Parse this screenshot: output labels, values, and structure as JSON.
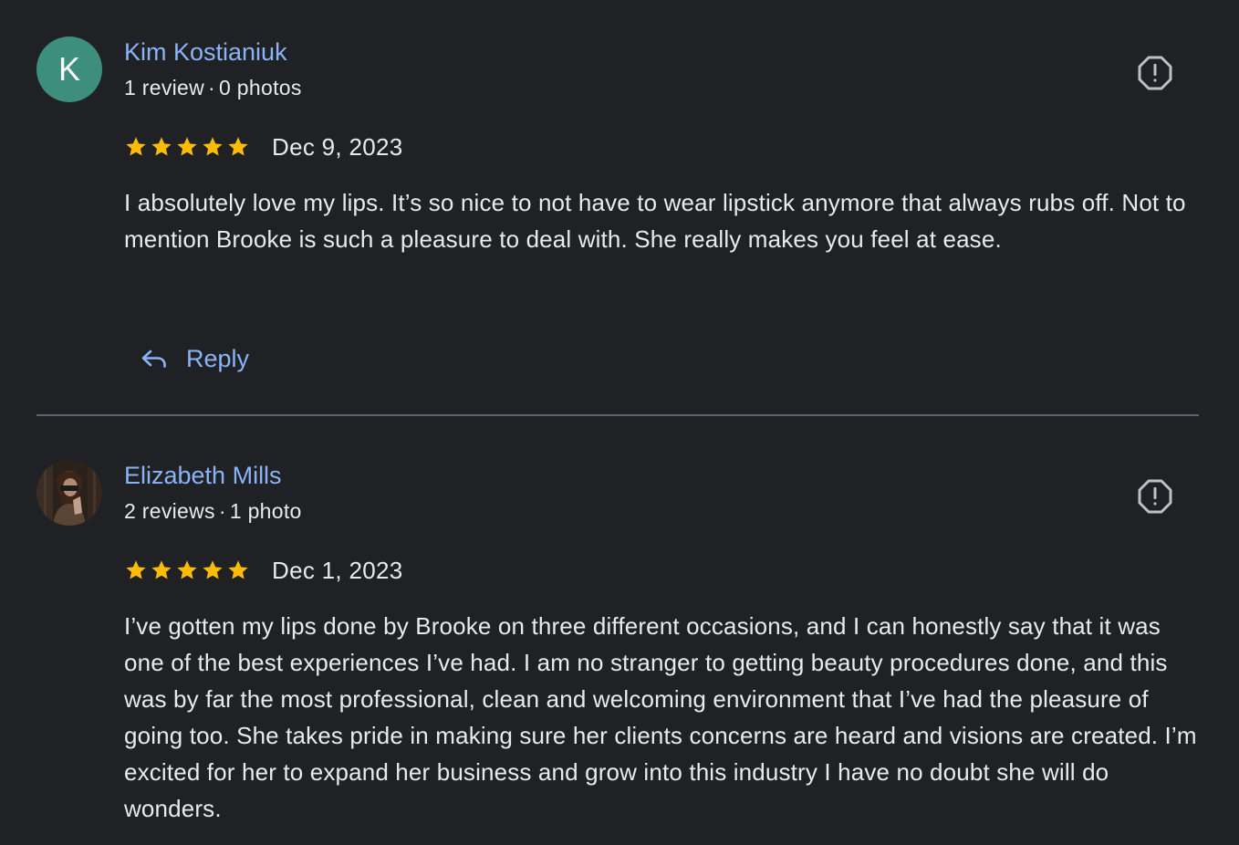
{
  "colors": {
    "background": "#202124",
    "link": "#8ab4f8",
    "text": "#e8eaed",
    "star": "#fbbc04",
    "avatar_k": "#3e8e7e",
    "divider": "#5f6368"
  },
  "reviews": [
    {
      "avatar_letter": "K",
      "author": "Kim Kostianiuk",
      "reviews_count": "1 review",
      "separator": "·",
      "photos_count": "0 photos",
      "rating": 5,
      "date": "Dec 9, 2023",
      "text": "I absolutely love my lips. It’s so nice to not have to wear lipstick anymore that always rubs off. Not to mention Brooke is such a pleasure to deal with. She really makes you feel at ease.",
      "reply_label": "Reply",
      "flag_icon": "report-flag-icon"
    },
    {
      "avatar_letter": "",
      "author": "Elizabeth Mills",
      "reviews_count": "2 reviews",
      "separator": "·",
      "photos_count": "1 photo",
      "rating": 5,
      "date": "Dec 1, 2023",
      "text": "I’ve gotten my lips done by Brooke on three different occasions, and I can honestly say that it was one of the best experiences I’ve had. I am no stranger to getting beauty procedures done, and this was by far the most professional, clean and welcoming environment that I’ve had the pleasure of going too. She takes pride in making sure her clients concerns are heard and visions are created. I’m excited for her to expand her business and grow into this industry I have no doubt she will do wonders.",
      "flag_icon": "report-flag-icon"
    }
  ]
}
